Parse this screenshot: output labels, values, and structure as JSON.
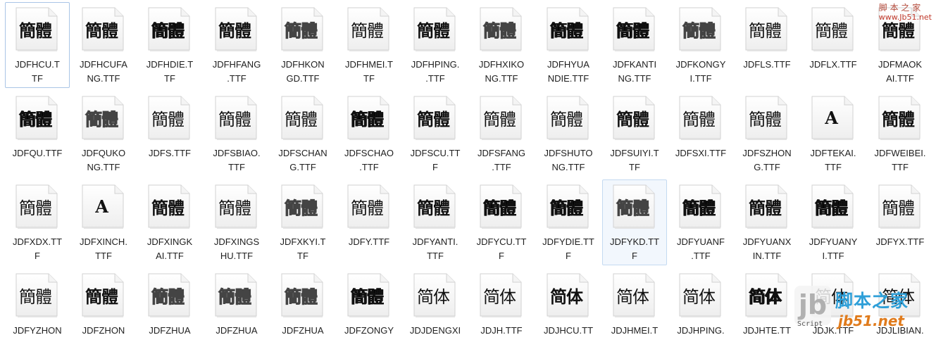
{
  "watermark_top": {
    "cn": "脚 本 之 家",
    "url": "www.Jb51.net"
  },
  "logo": {
    "mark": "jb",
    "script": "Script",
    "cn": "脚本之家",
    "url": "jb51.net"
  },
  "files": [
    {
      "name": [
        "JDFHCU.T",
        "TF"
      ],
      "glyph": "簡體",
      "style": "g-bold",
      "state": "selected"
    },
    {
      "name": [
        "JDFHCUFA",
        "NG.TTF"
      ],
      "glyph": "簡體",
      "style": "g-bold"
    },
    {
      "name": [
        "JDFHDIE.T",
        "TF"
      ],
      "glyph": "簡體",
      "style": "g-black"
    },
    {
      "name": [
        "JDFHFANG",
        ".TTF"
      ],
      "glyph": "簡體",
      "style": "g-bold"
    },
    {
      "name": [
        "JDFHKON",
        "GD.TTF"
      ],
      "glyph": "簡體",
      "style": "g-outline"
    },
    {
      "name": [
        "JDFHMEI.T",
        "TF"
      ],
      "glyph": "簡體",
      "style": "g-light"
    },
    {
      "name": [
        "JDFHPING.",
        ".TTF"
      ],
      "glyph": "簡體",
      "style": "g-bold"
    },
    {
      "name": [
        "JDFHXIKO",
        "NG.TTF"
      ],
      "glyph": "簡體",
      "style": "g-outline"
    },
    {
      "name": [
        "JDFHYUA",
        "NDIE.TTF"
      ],
      "glyph": "簡體",
      "style": "g-black"
    },
    {
      "name": [
        "JDFKANTI",
        "NG.TTF"
      ],
      "glyph": "簡體",
      "style": "g-black"
    },
    {
      "name": [
        "JDFKONGY",
        "I.TTF"
      ],
      "glyph": "簡體",
      "style": "g-outline"
    },
    {
      "name": [
        "JDFLS.TTF"
      ],
      "glyph": "簡體",
      "style": "g-light"
    },
    {
      "name": [
        "JDFLX.TTF"
      ],
      "glyph": "簡體",
      "style": "g-light"
    },
    {
      "name": [
        "JDFMAOK",
        "AI.TTF"
      ],
      "glyph": "簡體",
      "style": "g-bold"
    },
    {
      "name": [
        "JDFQU.TTF"
      ],
      "glyph": "簡體",
      "style": "g-black"
    },
    {
      "name": [
        "JDFQUKO",
        "NG.TTF"
      ],
      "glyph": "簡體",
      "style": "g-outline"
    },
    {
      "name": [
        "JDFS.TTF"
      ],
      "glyph": "簡體",
      "style": "g-light"
    },
    {
      "name": [
        "JDFSBIAO.",
        "TTF"
      ],
      "glyph": "簡體",
      "style": "g-light"
    },
    {
      "name": [
        "JDFSCHAN",
        "G.TTF"
      ],
      "glyph": "簡體",
      "style": "g-light"
    },
    {
      "name": [
        "JDFSCHAO",
        ".TTF"
      ],
      "glyph": "簡體",
      "style": "g-black"
    },
    {
      "name": [
        "JDFSCU.TT",
        "F"
      ],
      "glyph": "簡體",
      "style": "g-bold"
    },
    {
      "name": [
        "JDFSFANG",
        ".TTF"
      ],
      "glyph": "簡體",
      "style": "g-light"
    },
    {
      "name": [
        "JDFSHUTO",
        "NG.TTF"
      ],
      "glyph": "簡體",
      "style": "g-light"
    },
    {
      "name": [
        "JDFSUIYI.T",
        "TF"
      ],
      "glyph": "簡體",
      "style": "g-bold"
    },
    {
      "name": [
        "JDFSXI.TTF"
      ],
      "glyph": "簡體",
      "style": "g-faint"
    },
    {
      "name": [
        "JDFSZHON",
        "G.TTF"
      ],
      "glyph": "簡體",
      "style": "g-light"
    },
    {
      "name": [
        "JDFTEKAI.",
        "TTF"
      ],
      "glyph": "A",
      "style": "g-a"
    },
    {
      "name": [
        "JDFWEIBEI.",
        "TTF"
      ],
      "glyph": "簡體",
      "style": "g-bold"
    },
    {
      "name": [
        "JDFXDX.TT",
        "F"
      ],
      "glyph": "簡體",
      "style": "g-light"
    },
    {
      "name": [
        "JDFXINCH.",
        "TTF"
      ],
      "glyph": "A",
      "style": "g-a"
    },
    {
      "name": [
        "JDFXINGK",
        "AI.TTF"
      ],
      "glyph": "簡體",
      "style": "g-bold"
    },
    {
      "name": [
        "JDFXINGS",
        "HU.TTF"
      ],
      "glyph": "簡體",
      "style": "g-light"
    },
    {
      "name": [
        "JDFXKYI.T",
        "TF"
      ],
      "glyph": "簡體",
      "style": "g-outline"
    },
    {
      "name": [
        "JDFY.TTF"
      ],
      "glyph": "簡體",
      "style": "g-light"
    },
    {
      "name": [
        "JDFYANTI.",
        "TTF"
      ],
      "glyph": "簡體",
      "style": "g-bold"
    },
    {
      "name": [
        "JDFYCU.TT",
        "F"
      ],
      "glyph": "簡體",
      "style": "g-black"
    },
    {
      "name": [
        "JDFYDIE.TT",
        "F"
      ],
      "glyph": "簡體",
      "style": "g-black"
    },
    {
      "name": [
        "JDFYKD.TT",
        "F"
      ],
      "glyph": "簡體",
      "style": "g-outline",
      "state": "hover"
    },
    {
      "name": [
        "JDFYUANF",
        ".TTF"
      ],
      "glyph": "簡體",
      "style": "g-black"
    },
    {
      "name": [
        "JDFYUANX",
        "IN.TTF"
      ],
      "glyph": "簡體",
      "style": "g-bold"
    },
    {
      "name": [
        "JDFYUANY",
        "I.TTF"
      ],
      "glyph": "簡體",
      "style": "g-black"
    },
    {
      "name": [
        "JDFYX.TTF"
      ],
      "glyph": "簡體",
      "style": "g-light"
    },
    {
      "name": [
        "JDFYZHON"
      ],
      "glyph": "簡體",
      "style": "g-light"
    },
    {
      "name": [
        "JDFZHON"
      ],
      "glyph": "簡體",
      "style": "g-bold"
    },
    {
      "name": [
        "JDFZHUA"
      ],
      "glyph": "簡體",
      "style": "g-outline"
    },
    {
      "name": [
        "JDFZHUA"
      ],
      "glyph": "簡體",
      "style": "g-outline"
    },
    {
      "name": [
        "JDFZHUA"
      ],
      "glyph": "簡體",
      "style": "g-outline"
    },
    {
      "name": [
        "JDFZONGY"
      ],
      "glyph": "簡體",
      "style": "g-black"
    },
    {
      "name": [
        "JDJDENGXI"
      ],
      "glyph": "简体",
      "style": "g-sans g-light"
    },
    {
      "name": [
        "JDJH.TTF"
      ],
      "glyph": "简体",
      "style": "g-sans"
    },
    {
      "name": [
        "JDJHCU.TT"
      ],
      "glyph": "简体",
      "style": "g-sans g-bold"
    },
    {
      "name": [
        "JDJHMEI.T"
      ],
      "glyph": "简体",
      "style": "g-sans"
    },
    {
      "name": [
        "JDJHPING."
      ],
      "glyph": "简体",
      "style": "g-sans"
    },
    {
      "name": [
        "JDJHTE.TT"
      ],
      "glyph": "简体",
      "style": "g-sans g-black"
    },
    {
      "name": [
        "JDJK.TTF"
      ],
      "glyph": "简体",
      "style": "g-sans"
    },
    {
      "name": [
        "JDJLIBIAN."
      ],
      "glyph": "简体",
      "style": "g-sans"
    }
  ]
}
